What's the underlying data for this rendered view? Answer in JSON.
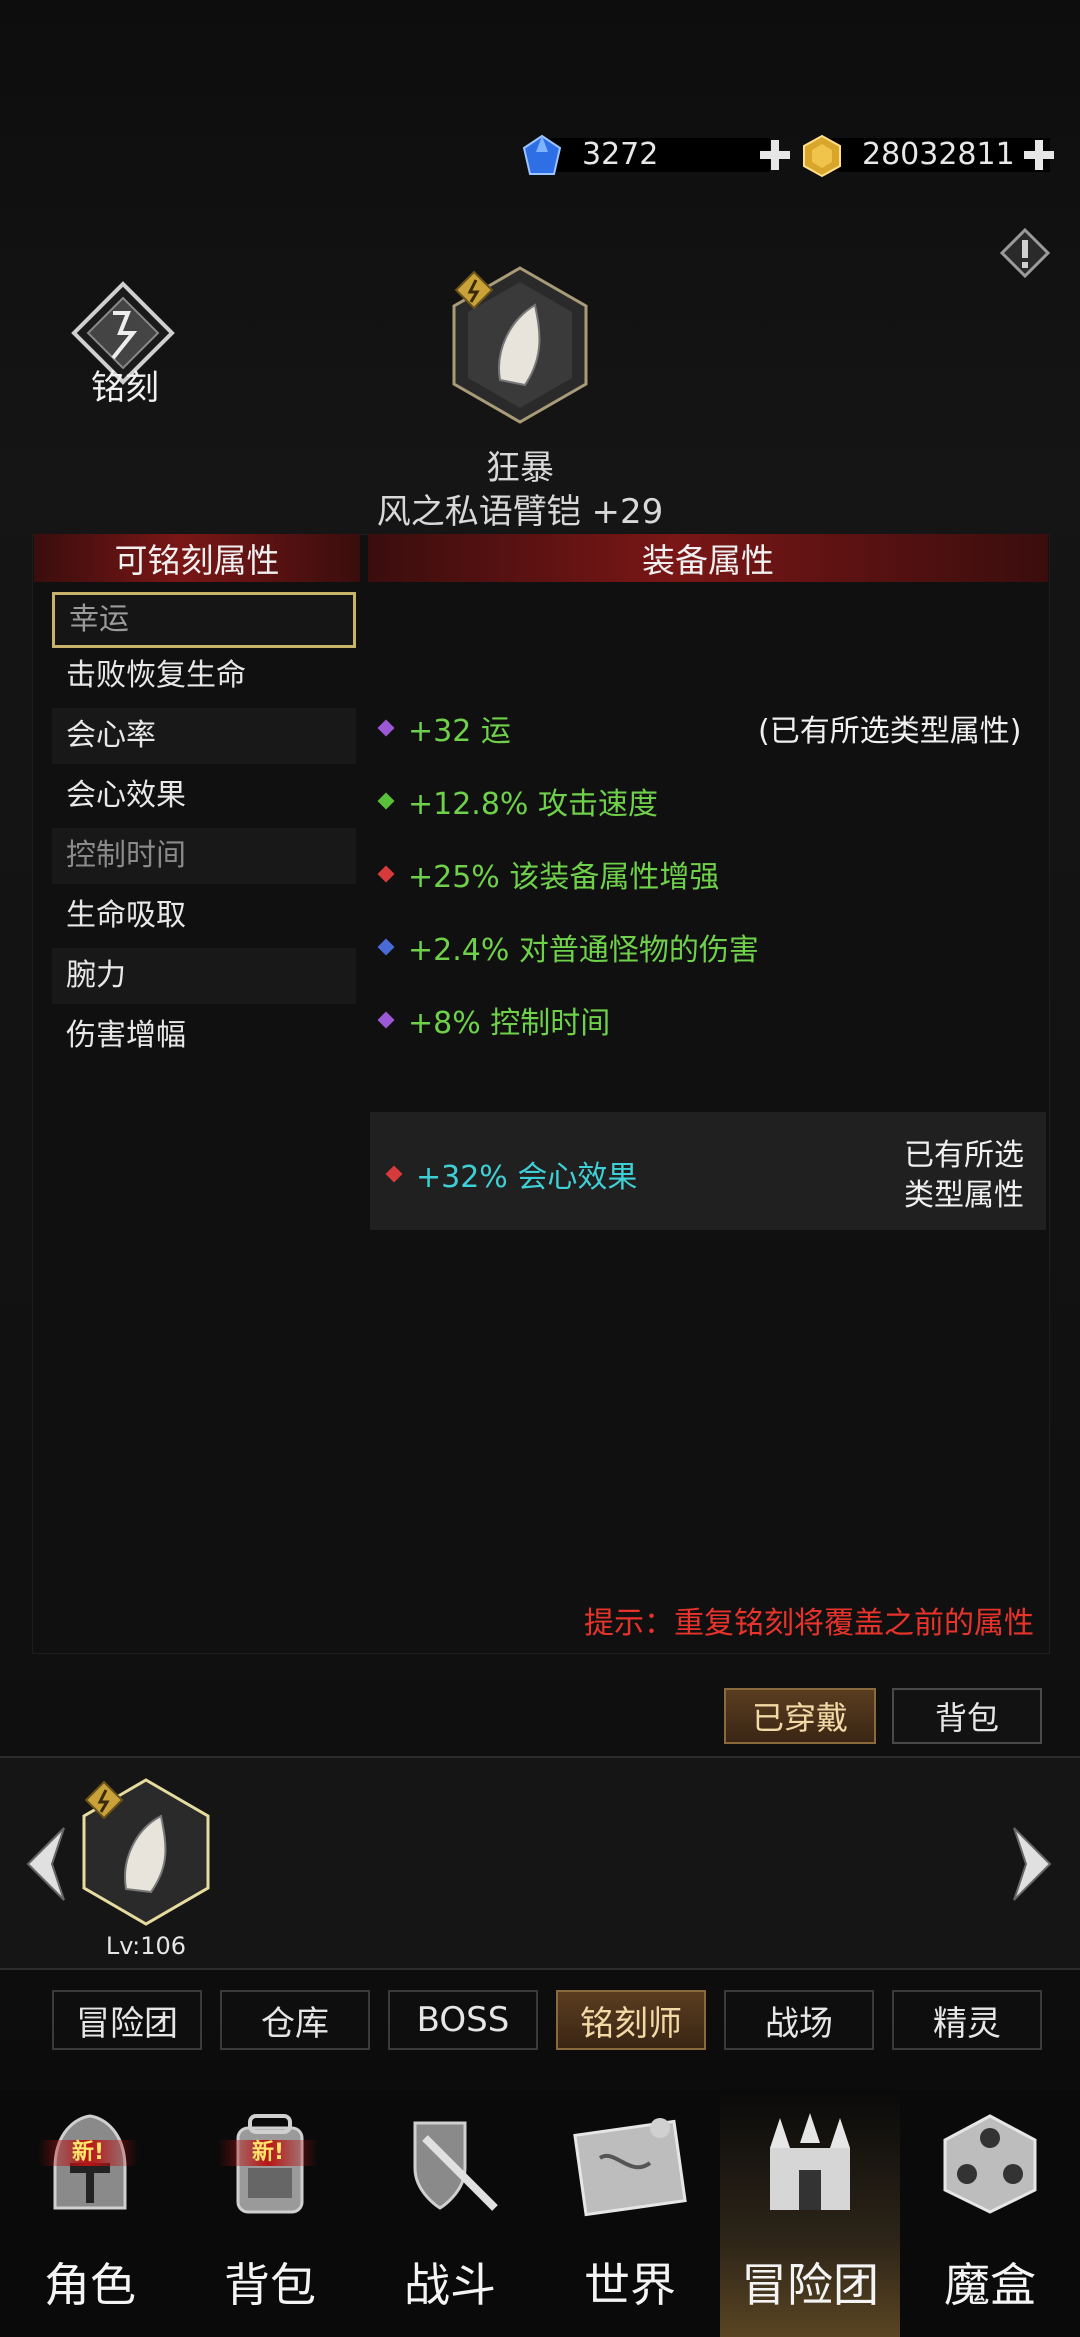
{
  "currency": {
    "gems": "3272",
    "gold": "28032811"
  },
  "inscribe": {
    "label": "铭刻"
  },
  "item": {
    "prefix": "狂暴",
    "name": "风之私语臂铠 +29",
    "level": "Lv:106"
  },
  "panels": {
    "left_header": "可铭刻属性",
    "right_header": "装备属性"
  },
  "inscribable_attributes": [
    {
      "label": "幸运",
      "state": "selected"
    },
    {
      "label": "击败恢复生命",
      "state": "normal"
    },
    {
      "label": "会心率",
      "state": "normal"
    },
    {
      "label": "会心效果",
      "state": "normal"
    },
    {
      "label": "控制时间",
      "state": "disabled"
    },
    {
      "label": "生命吸取",
      "state": "normal"
    },
    {
      "label": "腕力",
      "state": "normal"
    },
    {
      "label": "伤害增幅",
      "state": "normal"
    }
  ],
  "equipment_stats": [
    {
      "text": "+32 运",
      "dot": "#9b59d6",
      "note": "(已有所选类型属性)"
    },
    {
      "text": "+12.8% 攻击速度",
      "dot": "#59c03a"
    },
    {
      "text": "+25% 该装备属性增强",
      "dot": "#d63a3a"
    },
    {
      "text": "+2.4% 对普通怪物的伤害",
      "dot": "#4a6ad6"
    },
    {
      "text": "+8% 控制时间",
      "dot": "#9b59d6"
    }
  ],
  "special_stat": {
    "text": "+32% 会心效果",
    "dot": "#d63a3a",
    "note_line1": "已有所选",
    "note_line2": "类型属性"
  },
  "hint": "提示：重复铭刻将覆盖之前的属性",
  "buttons": {
    "equipped": "已穿戴",
    "backpack": "背包"
  },
  "tabs": [
    "冒险团",
    "仓库",
    "BOSS",
    "铭刻师",
    "战场",
    "精灵"
  ],
  "active_tab": "铭刻师",
  "nav": [
    {
      "label": "角色",
      "icon": "helmet-icon",
      "badge": "新!"
    },
    {
      "label": "背包",
      "icon": "backpack-icon",
      "badge": "新!"
    },
    {
      "label": "战斗",
      "icon": "shield-sword-icon"
    },
    {
      "label": "世界",
      "icon": "map-scroll-icon"
    },
    {
      "label": "冒险团",
      "icon": "castle-icon"
    },
    {
      "label": "魔盒",
      "icon": "magic-box-icon"
    }
  ],
  "colors": {
    "stat_green": "#6fd14a",
    "special_cyan": "#3fd0d6",
    "hint_red": "#e8332b",
    "header_red": "#7a1616",
    "gold_accent": "#c9b36a"
  }
}
